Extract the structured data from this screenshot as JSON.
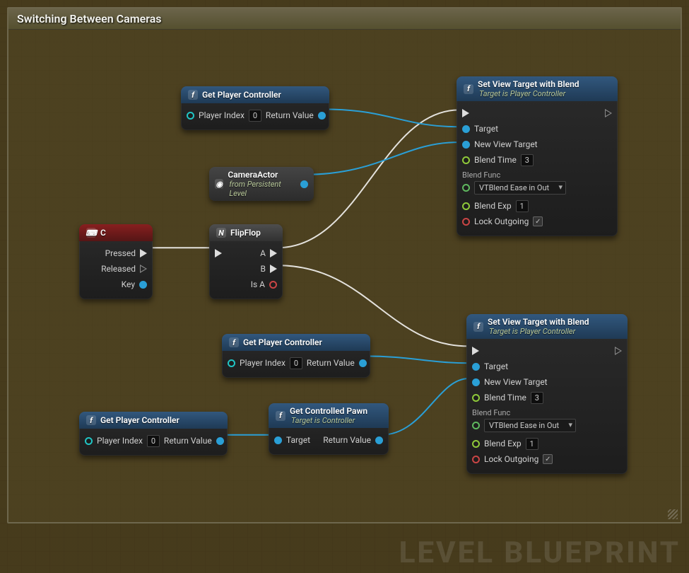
{
  "comment": {
    "title": "Switching Between Cameras"
  },
  "watermark": "LEVEL BLUEPRINT",
  "nodes": {
    "keyc": {
      "title": "C",
      "pressed": "Pressed",
      "released": "Released",
      "key": "Key"
    },
    "flipflop": {
      "title": "FlipFlop",
      "a": "A",
      "b": "B",
      "isa": "Is A"
    },
    "gpc1": {
      "title": "Get Player Controller",
      "playerIndex": "Player Index",
      "playerIndexVal": "0",
      "returnValue": "Return Value"
    },
    "gpc2": {
      "title": "Get Player Controller",
      "playerIndex": "Player Index",
      "playerIndexVal": "0",
      "returnValue": "Return Value"
    },
    "gpc3": {
      "title": "Get Player Controller",
      "playerIndex": "Player Index",
      "playerIndexVal": "0",
      "returnValue": "Return Value"
    },
    "camera": {
      "title": "CameraActor",
      "subtitle": "from Persistent Level"
    },
    "gpawn": {
      "title": "Get Controlled Pawn",
      "subtitle": "Target is Controller",
      "target": "Target",
      "returnValue": "Return Value"
    },
    "svt1": {
      "title": "Set View Target with Blend",
      "subtitle": "Target is Player Controller",
      "target": "Target",
      "newViewTarget": "New View Target",
      "blendTime": "Blend Time",
      "blendTimeVal": "3",
      "blendFunc": "Blend Func",
      "blendFuncVal": "VTBlend Ease in Out",
      "blendExp": "Blend Exp",
      "blendExpVal": "1",
      "lockOutgoing": "Lock Outgoing",
      "lockOutgoingChecked": "✓"
    },
    "svt2": {
      "title": "Set View Target with Blend",
      "subtitle": "Target is Player Controller",
      "target": "Target",
      "newViewTarget": "New View Target",
      "blendTime": "Blend Time",
      "blendTimeVal": "3",
      "blendFunc": "Blend Func",
      "blendFuncVal": "VTBlend Ease in Out",
      "blendExp": "Blend Exp",
      "blendExpVal": "1",
      "lockOutgoing": "Lock Outgoing",
      "lockOutgoingChecked": "✓"
    }
  }
}
